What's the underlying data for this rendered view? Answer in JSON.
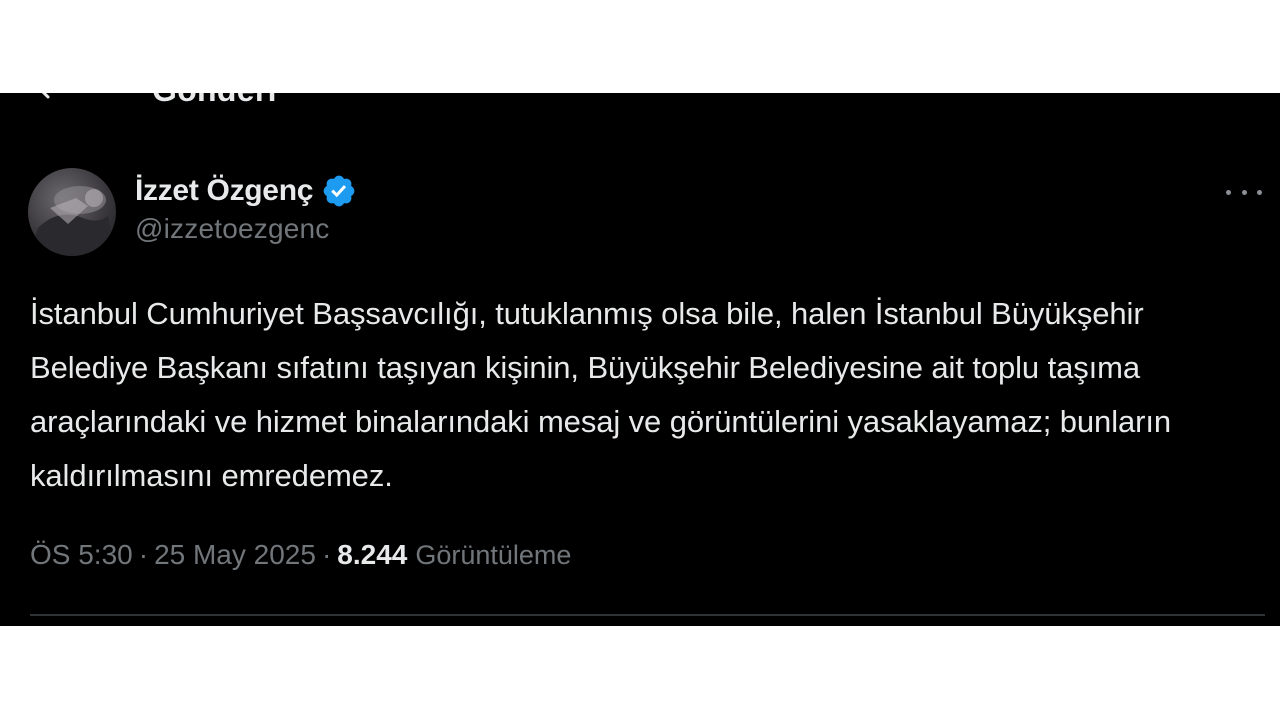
{
  "header": {
    "title": "Gönderi",
    "back_icon": "arrow-left-icon"
  },
  "tweet": {
    "author": {
      "display_name": "İzzet Özgenç",
      "handle": "@izzetoezgenc",
      "verified": true,
      "verified_color": "#1d9bf0"
    },
    "text": "İstanbul Cumhuriyet Başsavcılığı, tutuklanmış olsa bile, halen İstanbul Büyükşehir Belediye Başkanı sıfatını taşıyan kişinin, Büyükşehir Belediyesine ait toplu taşıma araçlarındaki ve hizmet binalarındaki mesaj ve görüntülerini yasaklayamaz; bunların kaldırılmasını emredemez.",
    "time": "ÖS 5:30",
    "separator": "·",
    "date": "25 May 2025",
    "views_count": "8.244",
    "views_label": "Görüntüleme",
    "more_icon": "more-horizontal-icon"
  },
  "colors": {
    "background": "#000000",
    "text_primary": "#e7e9ea",
    "text_secondary": "#71767b",
    "divider": "#2f3336"
  }
}
